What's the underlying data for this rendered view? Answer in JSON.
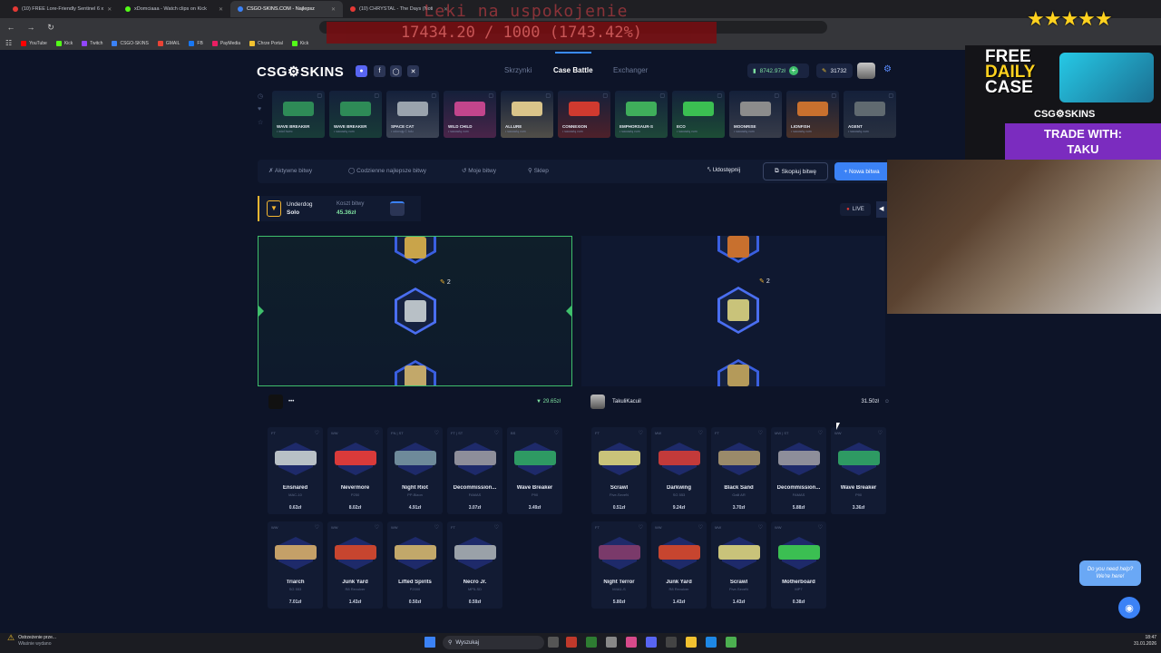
{
  "browser": {
    "tabs": [
      {
        "title": "(10) FREE Lore-Friendly Sentinel 6 x",
        "color": "#e53935"
      },
      {
        "title": "xDomciaaa - Watch clips on Kick",
        "color": "#53fc18"
      },
      {
        "title": "CSGO-SKINS.COM - Najlepsz",
        "color": "#3b82f6"
      },
      {
        "title": "(10) CHRYSTAL - The Days (Noti",
        "color": "#e53935"
      }
    ],
    "bookmarks": [
      "YouTube",
      "Kick",
      "Twitch",
      "CSGO-SKINS",
      "GMAIL",
      "FB",
      "PayMedia",
      "Chrze Portal",
      "Kick"
    ]
  },
  "overlay": {
    "donation_title": "Leki na uspokojenie",
    "donation_amount": "17434.20 / 1000 (1743.42%)"
  },
  "site": {
    "logo": "CSG⚙SKINS",
    "nav": [
      "Skrzynki",
      "Case Battle",
      "Exchanger"
    ],
    "balance": "8742.97zł",
    "points": "31732",
    "drops": [
      {
        "name": "WAVE BREAKER",
        "sub": "• wód hum•",
        "color": "#2e8b57"
      },
      {
        "name": "WAVE BREAKER",
        "sub": "• sauuwią vum",
        "color": "#2e8b57"
      },
      {
        "name": "SPACE CAT",
        "sub": "• odovuję Ć tulu",
        "color": "#9aa3ad"
      },
      {
        "name": "WILD CHILD",
        "sub": "• sauuwią vum",
        "color": "#c2458c"
      },
      {
        "name": "ALLURE",
        "sub": "• sauuwią vum",
        "color": "#d9c48a"
      },
      {
        "name": "CONNEXION",
        "sub": "• sauuwią vum",
        "color": "#cf3a2f"
      },
      {
        "name": "EMPHORSAUR-S",
        "sub": "• sauuwią vum",
        "color": "#3fae5b"
      },
      {
        "name": "ECO",
        "sub": "• sauuwią vum",
        "color": "#3bbf52"
      },
      {
        "name": "MOONRISE",
        "sub": "• sauuwią vum",
        "color": "#8c8c8c"
      },
      {
        "name": "LIONFISH",
        "sub": "• sauuwią vum",
        "color": "#c8702e"
      },
      {
        "name": "AGENT",
        "sub": "• sauuwią vum",
        "color": "#606a70"
      }
    ],
    "subnav": [
      "Aktywne bitwy",
      "Codzienne najlepsze bitwy",
      "Moje bitwy",
      "Sklep"
    ],
    "share": "Udostępnij",
    "copy_battle": "Skopiuj bitwę",
    "new_battle": "+ Nowa bitwa",
    "mode_title": "Underdog",
    "mode_sub": "Solo",
    "cost_label": "Koszt bitwy",
    "cost_value": "45.36zł",
    "live": "LIVE",
    "multiplier": "2",
    "players": [
      {
        "name": "•••",
        "total": "29.65zł"
      },
      {
        "name": "TakuliKacuil",
        "total": "31.50zł"
      }
    ],
    "items_left": [
      {
        "cond": "FT",
        "name": "Ensnared",
        "weapon": "MAC-10",
        "value": "0.63zł",
        "color": "#b8c0c6"
      },
      {
        "cond": "WW",
        "name": "Nevermore",
        "weapon": "P250",
        "value": "8.02zł",
        "color": "#d93a3a"
      },
      {
        "cond": "FN | ST",
        "name": "Night Riot",
        "weapon": "PP-Bizon",
        "value": "4.91zł",
        "color": "#6e8a9a"
      },
      {
        "cond": "FT | ST",
        "name": "Decommission...",
        "weapon": "FAMAS",
        "value": "3.07zł",
        "color": "#8e8e9a"
      },
      {
        "cond": "BS",
        "name": "Wave Breaker",
        "weapon": "P90",
        "value": "3.49zł",
        "color": "#2e9a63"
      },
      {
        "cond": "WW",
        "name": "Triarch",
        "weapon": "SG 553",
        "value": "7.01zł",
        "color": "#c4a068"
      },
      {
        "cond": "WW",
        "name": "Junk Yard",
        "weapon": "R8 Revolver",
        "value": "1.43zł",
        "color": "#c7452f"
      },
      {
        "cond": "WW",
        "name": "Lifted Spirits",
        "weapon": "P2000",
        "value": "0.50zł",
        "color": "#c2a86a"
      },
      {
        "cond": "FT",
        "name": "Necro Jr.",
        "weapon": "MP5-SD",
        "value": "0.59zł",
        "color": "#9aa1a8"
      }
    ],
    "items_right": [
      {
        "cond": "FT",
        "name": "Scrawl",
        "weapon": "Five-SeveN",
        "value": "0.51zł",
        "color": "#c9c37a"
      },
      {
        "cond": "MW",
        "name": "Darkwing",
        "weapon": "SG 553",
        "value": "9.24zł",
        "color": "#c33a3a"
      },
      {
        "cond": "FT",
        "name": "Black Sand",
        "weapon": "Galil AR",
        "value": "3.70zł",
        "color": "#9a8a6a"
      },
      {
        "cond": "MW | ST",
        "name": "Decommission...",
        "weapon": "FAMAS",
        "value": "5.88zł",
        "color": "#8e8e9a"
      },
      {
        "cond": "WW",
        "name": "Wave Breaker",
        "weapon": "P90",
        "value": "3.36zł",
        "color": "#2e9a63"
      },
      {
        "cond": "FT",
        "name": "Night Terror",
        "weapon": "M4A1-S",
        "value": "5.80zł",
        "color": "#7a3a6a"
      },
      {
        "cond": "WW",
        "name": "Junk Yard",
        "weapon": "R8 Revolver",
        "value": "1.43zł",
        "color": "#c7452f"
      },
      {
        "cond": "MW",
        "name": "Scrawl",
        "weapon": "Five-SeveN",
        "value": "1.43zł",
        "color": "#c9c37a"
      },
      {
        "cond": "WW",
        "name": "Motherboard",
        "weapon": "MP7",
        "value": "0.38zł",
        "color": "#3bbf52"
      }
    ]
  },
  "promo": {
    "free_line1": "FREE",
    "free_line2": "DAILY",
    "free_line3": "CASE",
    "brand": "CSG⚙SKINS",
    "trade_line1": "TRADE WITH:",
    "trade_line2": "TAKU"
  },
  "help": {
    "text1": "Do you need help?",
    "text2": "We're here!"
  },
  "taskbar": {
    "search": "Wyszukaj",
    "warning_title": "Ostrzeżenie prze...",
    "warning_sub": "Właśnie wydano",
    "time": "18:47",
    "date": "31.01.2026"
  }
}
